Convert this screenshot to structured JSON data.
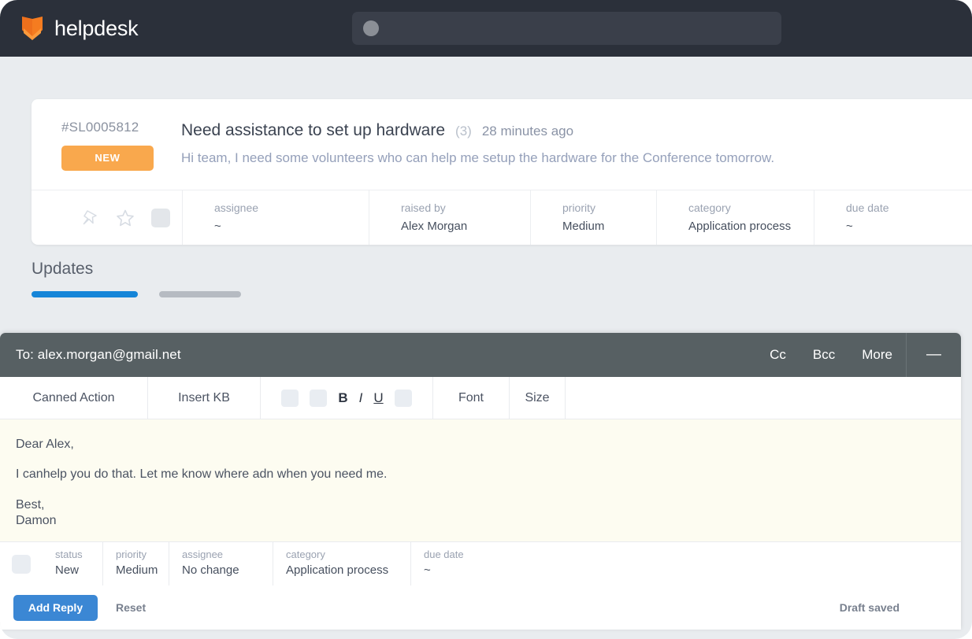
{
  "nav": {
    "brand": "helpdesk",
    "logo_color": "#f57c20",
    "search_placeholder": ""
  },
  "ticket": {
    "id": "#SL0005812",
    "status_badge": "NEW",
    "badge_color": "#f9a84d",
    "title": "Need assistance to set up hardware",
    "reply_count": "(3)",
    "time_ago": "28 minutes ago",
    "description": "Hi team, I need some volunteers who can help me setup the hardware for the Conference tomorrow.",
    "meta": [
      {
        "label": "assignee",
        "value": "~"
      },
      {
        "label": "raised by",
        "value": "Alex Morgan"
      },
      {
        "label": "priority",
        "value": "Medium"
      },
      {
        "label": "category",
        "value": "Application process"
      },
      {
        "label": "due date",
        "value": "~"
      }
    ]
  },
  "updates": {
    "title": "Updates",
    "active_color": "#1585d8",
    "idle_color": "#b6bbc2"
  },
  "compose": {
    "to": "To: alex.morgan@gmail.net",
    "cc": "Cc",
    "bcc": "Bcc",
    "more": "More",
    "minimize": "—",
    "toolbar": {
      "canned_action": "Canned Action",
      "insert_kb": "Insert KB",
      "bold": "B",
      "italic": "I",
      "underline": "U",
      "font": "Font",
      "size": "Size"
    },
    "body": {
      "greeting": "Dear Alex,",
      "paragraph": "I canhelp you do that. Let me know where adn when you need me.",
      "signoff": "Best,",
      "signature": "Damon"
    },
    "reply_meta": [
      {
        "label": "status",
        "value": "New"
      },
      {
        "label": "priority",
        "value": "Medium"
      },
      {
        "label": "assignee",
        "value": "No change"
      },
      {
        "label": "category",
        "value": "Application process"
      },
      {
        "label": "due date",
        "value": "~"
      }
    ],
    "footer": {
      "add_reply": "Add Reply",
      "reset": "Reset",
      "draft_status": "Draft saved",
      "primary_color": "#3b87d4"
    }
  }
}
